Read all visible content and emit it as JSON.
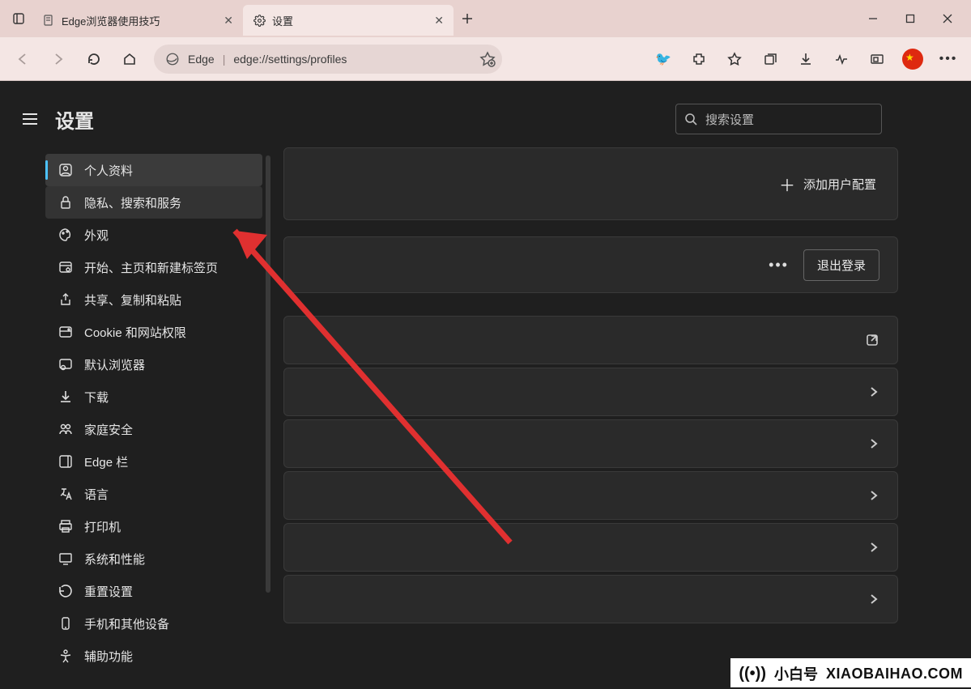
{
  "tabs": {
    "t1": {
      "label": "Edge浏览器使用技巧"
    },
    "t2": {
      "label": "设置"
    }
  },
  "address": {
    "brand": "Edge",
    "url": "edge://settings/profiles"
  },
  "settings": {
    "title": "设置",
    "search_placeholder": "搜索设置"
  },
  "sidebar": {
    "items": [
      {
        "label": "个人资料"
      },
      {
        "label": "隐私、搜索和服务"
      },
      {
        "label": "外观"
      },
      {
        "label": "开始、主页和新建标签页"
      },
      {
        "label": "共享、复制和粘贴"
      },
      {
        "label": "Cookie 和网站权限"
      },
      {
        "label": "默认浏览器"
      },
      {
        "label": "下载"
      },
      {
        "label": "家庭安全"
      },
      {
        "label": "Edge 栏"
      },
      {
        "label": "语言"
      },
      {
        "label": "打印机"
      },
      {
        "label": "系统和性能"
      },
      {
        "label": "重置设置"
      },
      {
        "label": "手机和其他设备"
      },
      {
        "label": "辅助功能"
      }
    ]
  },
  "main": {
    "add_profile": "添加用户配置",
    "sign_out": "退出登录"
  },
  "watermark": {
    "cn": "小白号",
    "en": "XIAOBAIHAO.COM"
  },
  "footer": {
    "cn": "小白号",
    "en": "XIAOBAIHAO.COM"
  }
}
